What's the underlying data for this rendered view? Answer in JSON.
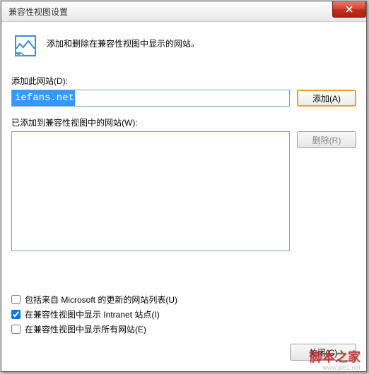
{
  "window": {
    "title": "兼容性视图设置"
  },
  "header": {
    "description": "添加和删除在兼容性视图中显示的网站。"
  },
  "add_section": {
    "label": "添加此网站(D):",
    "input_value": "iefans.net",
    "add_button": "添加(A)"
  },
  "list_section": {
    "label": "已添加到兼容性视图中的网站(W):",
    "remove_button": "删除(R)"
  },
  "checkboxes": {
    "include_microsoft": {
      "label": "包括来自 Microsoft 的更新的网站列表(U)",
      "checked": false
    },
    "intranet": {
      "label": "在兼容性视图中显示 Intranet 站点(I)",
      "checked": true
    },
    "all_sites": {
      "label": "在兼容性视图中显示所有网站(E)",
      "checked": false
    }
  },
  "footer": {
    "close_button": "关闭(C)"
  },
  "watermark": {
    "main": "脚本之家",
    "sub": "www.jb51.net"
  }
}
